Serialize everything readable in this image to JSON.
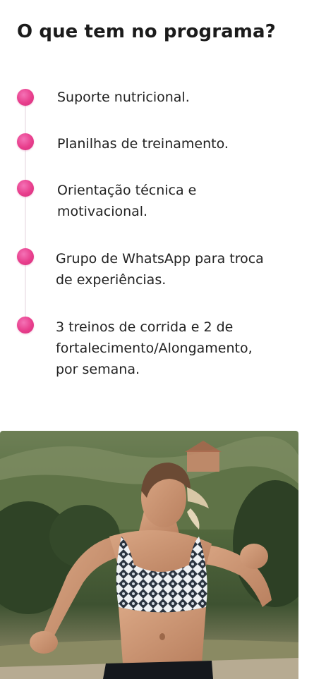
{
  "section": {
    "title": "O que tem no programa?"
  },
  "items": [
    {
      "lines": [
        "Suporte nutricional."
      ]
    },
    {
      "lines": [
        "Planilhas de treinamento."
      ]
    },
    {
      "lines": [
        "Orientação técnica e",
        "motivacional."
      ]
    },
    {
      "lines": [
        "Grupo de WhatsApp para troca",
        "de experiências."
      ]
    },
    {
      "lines": [
        "3 treinos de corrida e 2 de",
        "fortalecimento/Alongamento,",
        "por semana."
      ]
    }
  ],
  "colors": {
    "accent": "#e83e8c",
    "text": "#222222"
  },
  "photo": {
    "subject": "woman-running-outdoors"
  }
}
